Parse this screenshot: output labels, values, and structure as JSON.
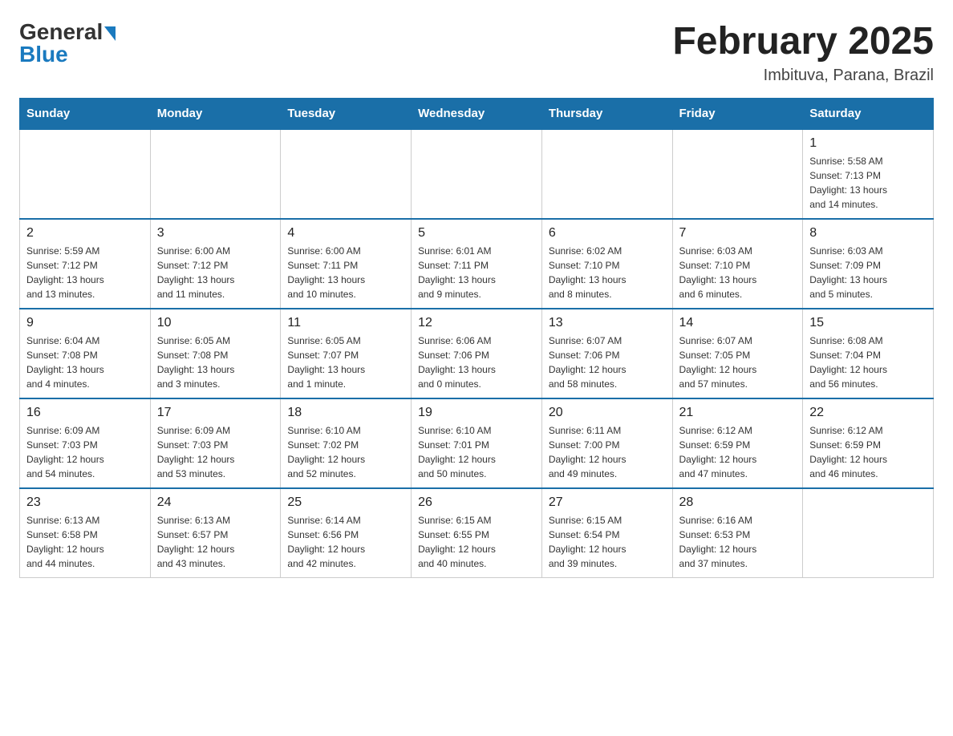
{
  "header": {
    "logo_general": "General",
    "logo_blue": "Blue",
    "month_title": "February 2025",
    "location": "Imbituva, Parana, Brazil"
  },
  "weekdays": [
    "Sunday",
    "Monday",
    "Tuesday",
    "Wednesday",
    "Thursday",
    "Friday",
    "Saturday"
  ],
  "weeks": [
    [
      {
        "day": "",
        "info": ""
      },
      {
        "day": "",
        "info": ""
      },
      {
        "day": "",
        "info": ""
      },
      {
        "day": "",
        "info": ""
      },
      {
        "day": "",
        "info": ""
      },
      {
        "day": "",
        "info": ""
      },
      {
        "day": "1",
        "info": "Sunrise: 5:58 AM\nSunset: 7:13 PM\nDaylight: 13 hours\nand 14 minutes."
      }
    ],
    [
      {
        "day": "2",
        "info": "Sunrise: 5:59 AM\nSunset: 7:12 PM\nDaylight: 13 hours\nand 13 minutes."
      },
      {
        "day": "3",
        "info": "Sunrise: 6:00 AM\nSunset: 7:12 PM\nDaylight: 13 hours\nand 11 minutes."
      },
      {
        "day": "4",
        "info": "Sunrise: 6:00 AM\nSunset: 7:11 PM\nDaylight: 13 hours\nand 10 minutes."
      },
      {
        "day": "5",
        "info": "Sunrise: 6:01 AM\nSunset: 7:11 PM\nDaylight: 13 hours\nand 9 minutes."
      },
      {
        "day": "6",
        "info": "Sunrise: 6:02 AM\nSunset: 7:10 PM\nDaylight: 13 hours\nand 8 minutes."
      },
      {
        "day": "7",
        "info": "Sunrise: 6:03 AM\nSunset: 7:10 PM\nDaylight: 13 hours\nand 6 minutes."
      },
      {
        "day": "8",
        "info": "Sunrise: 6:03 AM\nSunset: 7:09 PM\nDaylight: 13 hours\nand 5 minutes."
      }
    ],
    [
      {
        "day": "9",
        "info": "Sunrise: 6:04 AM\nSunset: 7:08 PM\nDaylight: 13 hours\nand 4 minutes."
      },
      {
        "day": "10",
        "info": "Sunrise: 6:05 AM\nSunset: 7:08 PM\nDaylight: 13 hours\nand 3 minutes."
      },
      {
        "day": "11",
        "info": "Sunrise: 6:05 AM\nSunset: 7:07 PM\nDaylight: 13 hours\nand 1 minute."
      },
      {
        "day": "12",
        "info": "Sunrise: 6:06 AM\nSunset: 7:06 PM\nDaylight: 13 hours\nand 0 minutes."
      },
      {
        "day": "13",
        "info": "Sunrise: 6:07 AM\nSunset: 7:06 PM\nDaylight: 12 hours\nand 58 minutes."
      },
      {
        "day": "14",
        "info": "Sunrise: 6:07 AM\nSunset: 7:05 PM\nDaylight: 12 hours\nand 57 minutes."
      },
      {
        "day": "15",
        "info": "Sunrise: 6:08 AM\nSunset: 7:04 PM\nDaylight: 12 hours\nand 56 minutes."
      }
    ],
    [
      {
        "day": "16",
        "info": "Sunrise: 6:09 AM\nSunset: 7:03 PM\nDaylight: 12 hours\nand 54 minutes."
      },
      {
        "day": "17",
        "info": "Sunrise: 6:09 AM\nSunset: 7:03 PM\nDaylight: 12 hours\nand 53 minutes."
      },
      {
        "day": "18",
        "info": "Sunrise: 6:10 AM\nSunset: 7:02 PM\nDaylight: 12 hours\nand 52 minutes."
      },
      {
        "day": "19",
        "info": "Sunrise: 6:10 AM\nSunset: 7:01 PM\nDaylight: 12 hours\nand 50 minutes."
      },
      {
        "day": "20",
        "info": "Sunrise: 6:11 AM\nSunset: 7:00 PM\nDaylight: 12 hours\nand 49 minutes."
      },
      {
        "day": "21",
        "info": "Sunrise: 6:12 AM\nSunset: 6:59 PM\nDaylight: 12 hours\nand 47 minutes."
      },
      {
        "day": "22",
        "info": "Sunrise: 6:12 AM\nSunset: 6:59 PM\nDaylight: 12 hours\nand 46 minutes."
      }
    ],
    [
      {
        "day": "23",
        "info": "Sunrise: 6:13 AM\nSunset: 6:58 PM\nDaylight: 12 hours\nand 44 minutes."
      },
      {
        "day": "24",
        "info": "Sunrise: 6:13 AM\nSunset: 6:57 PM\nDaylight: 12 hours\nand 43 minutes."
      },
      {
        "day": "25",
        "info": "Sunrise: 6:14 AM\nSunset: 6:56 PM\nDaylight: 12 hours\nand 42 minutes."
      },
      {
        "day": "26",
        "info": "Sunrise: 6:15 AM\nSunset: 6:55 PM\nDaylight: 12 hours\nand 40 minutes."
      },
      {
        "day": "27",
        "info": "Sunrise: 6:15 AM\nSunset: 6:54 PM\nDaylight: 12 hours\nand 39 minutes."
      },
      {
        "day": "28",
        "info": "Sunrise: 6:16 AM\nSunset: 6:53 PM\nDaylight: 12 hours\nand 37 minutes."
      },
      {
        "day": "",
        "info": ""
      }
    ]
  ]
}
